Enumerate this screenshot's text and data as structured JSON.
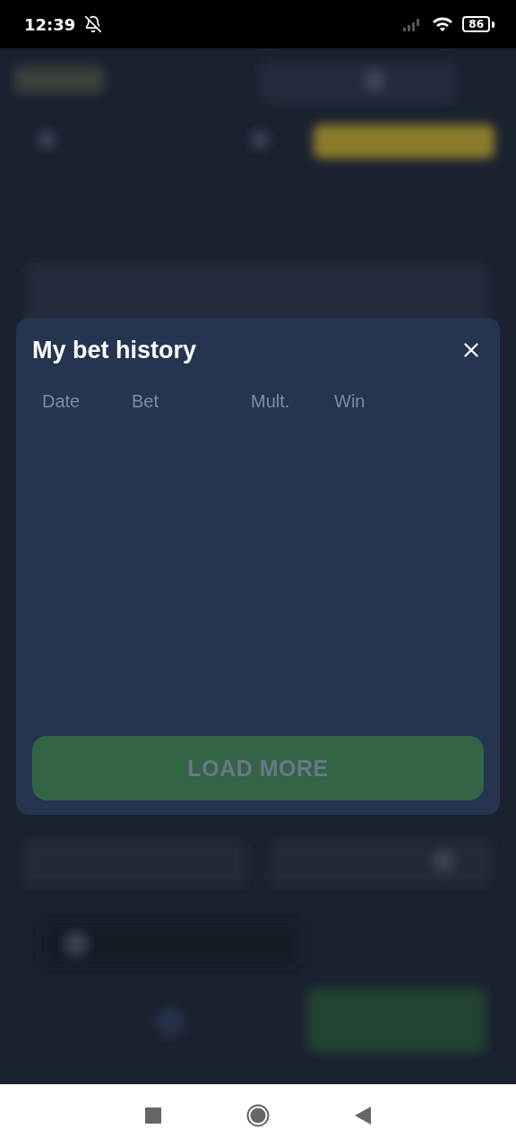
{
  "status_bar": {
    "time": "12:39",
    "battery": "86"
  },
  "dialog": {
    "title": "My bet history",
    "columns": [
      "Date",
      "Bet",
      "Mult.",
      "Win"
    ],
    "load_more": {
      "label": "LOAD MORE",
      "disabled": true
    }
  }
}
